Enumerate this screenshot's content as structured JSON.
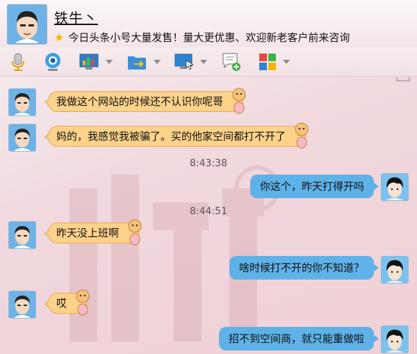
{
  "contact": {
    "name": "铁牛丶",
    "signature": "今日头条小号大量发售！量大更优惠、欢迎新老客户前来咨询"
  },
  "toolbar": {
    "buttons": [
      {
        "icon": "microphone-icon"
      },
      {
        "icon": "webcam-icon"
      },
      {
        "icon": "screen-share-icon"
      },
      {
        "icon": "file-transfer-icon"
      },
      {
        "icon": "remote-desktop-icon"
      },
      {
        "icon": "new-chat-icon"
      },
      {
        "icon": "apps-grid-icon"
      }
    ]
  },
  "messages": [
    {
      "type": "in",
      "text": "我做这个网站的时候还不认识你呢哥"
    },
    {
      "type": "in",
      "text": "妈的，我感觉我被骗了。买的他家空间都打不开了"
    },
    {
      "type": "time",
      "text": "8:43:38"
    },
    {
      "type": "out",
      "text": "你这个，昨天打得开吗"
    },
    {
      "type": "time",
      "text": "8:44:51"
    },
    {
      "type": "in",
      "text": "昨天没上班啊"
    },
    {
      "type": "out",
      "text": "啥时候打不开的你不知道？"
    },
    {
      "type": "in",
      "text": "哎"
    },
    {
      "type": "out",
      "text": "招不到空间商，就只能重做啦"
    }
  ],
  "colors": {
    "incoming_bubble": "#fdd28b",
    "outgoing_bubble": "#5fb2e8",
    "background": "#f1d9de"
  }
}
